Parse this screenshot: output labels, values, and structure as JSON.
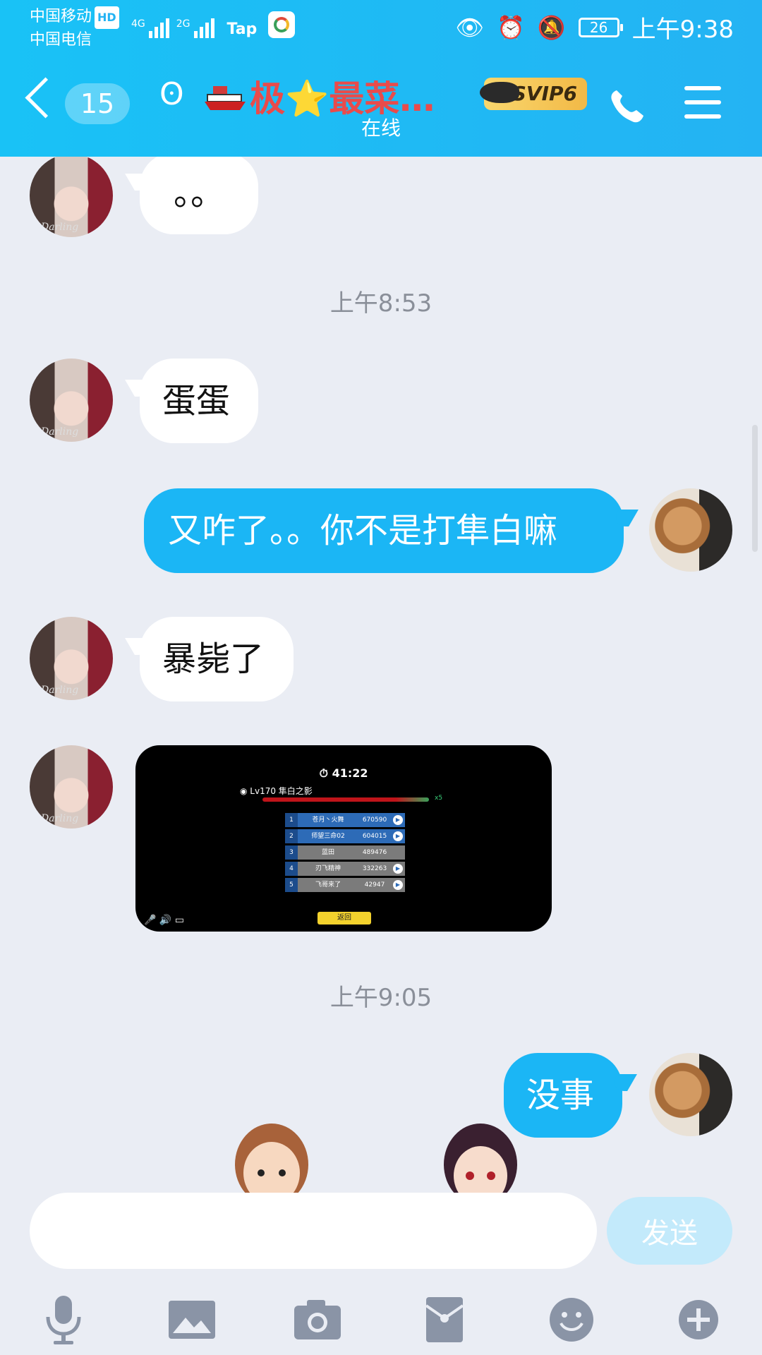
{
  "status_bar": {
    "carrier1": "中国移动",
    "hd_badge": "HD",
    "carrier2": "中国电信",
    "net1": "4G",
    "net2": "2G",
    "tap_label": "Tap",
    "battery": "26",
    "time": "上午9:38"
  },
  "header": {
    "unread_count": "15",
    "title": "极⭐最菜颜...",
    "subtitle": "在线",
    "badge": "SVIP6"
  },
  "messages": [
    {
      "side": "in",
      "text": "。。"
    },
    {
      "time": "上午8:53"
    },
    {
      "side": "in",
      "text": "蛋蛋"
    },
    {
      "side": "out",
      "text": "又咋了。。你不是打隼白嘛"
    },
    {
      "side": "in",
      "text": "暴毙了"
    },
    {
      "time": "上午9:05"
    },
    {
      "side": "out",
      "text": "没事"
    }
  ],
  "game_card": {
    "timer": "41:22",
    "player": "Lv170 隼白之影",
    "multiplier": "x5",
    "rows": [
      {
        "rank": "1",
        "name": "苍月丶火舞",
        "score": "670590"
      },
      {
        "rank": "2",
        "name": "师望三命02",
        "score": "604015"
      },
      {
        "rank": "3",
        "name": "蓝田",
        "score": "489476"
      },
      {
        "rank": "4",
        "name": "刃飞精神",
        "score": "332263"
      },
      {
        "rank": "5",
        "name": "飞哥来了",
        "score": "42947"
      }
    ],
    "button": "返回"
  },
  "input": {
    "value": "",
    "placeholder": "",
    "send_label": "发送"
  },
  "colors": {
    "header_bg": "#1fbaf5",
    "outgoing_bubble": "#1bb6f5",
    "incoming_bubble": "#ffffff",
    "chat_bg": "#eaedf4",
    "title_red": "#e94b4b"
  },
  "icons": [
    "back-icon",
    "ear-icon",
    "phone-icon",
    "menu-icon",
    "microphone-icon",
    "image-icon",
    "camera-icon",
    "red-packet-icon",
    "emoji-icon",
    "plus-icon"
  ]
}
